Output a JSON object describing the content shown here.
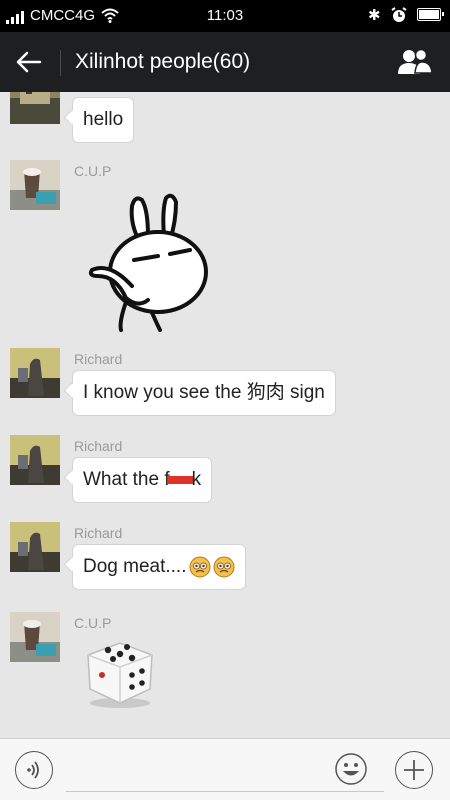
{
  "status_bar": {
    "carrier": "CMCC4G",
    "time": "11:03"
  },
  "header": {
    "title": "Xilinhot people(60)",
    "back_icon": "back-arrow-icon",
    "group_icon": "group-members-icon"
  },
  "messages": [
    {
      "sender": "",
      "type": "text",
      "text": "hello"
    },
    {
      "sender": "C.U.P",
      "type": "sticker",
      "sticker": "rabbit-sticker"
    },
    {
      "sender": "Richard",
      "type": "text",
      "text": "I know you see the 狗肉 sign"
    },
    {
      "sender": "Richard",
      "type": "text",
      "text_before": "What the f",
      "text_after": "k",
      "censor": "censored-mark"
    },
    {
      "sender": "Richard",
      "type": "text",
      "text": "Dog meat....",
      "emojis": [
        "worried-face-icon",
        "worried-face-icon"
      ]
    },
    {
      "sender": "C.U.P",
      "type": "sticker",
      "sticker": "dice-sticker"
    }
  ],
  "input_bar": {
    "placeholder": "",
    "voice_icon": "voice-icon",
    "emoji_icon": "smiley-icon",
    "plus_icon": "plus-icon"
  },
  "colors": {
    "status_bar": "#000000",
    "title_bar": "#1d1f21",
    "chat_bg": "#e6e6e6",
    "bubble": "#ffffff",
    "censor": "#e0332a"
  }
}
